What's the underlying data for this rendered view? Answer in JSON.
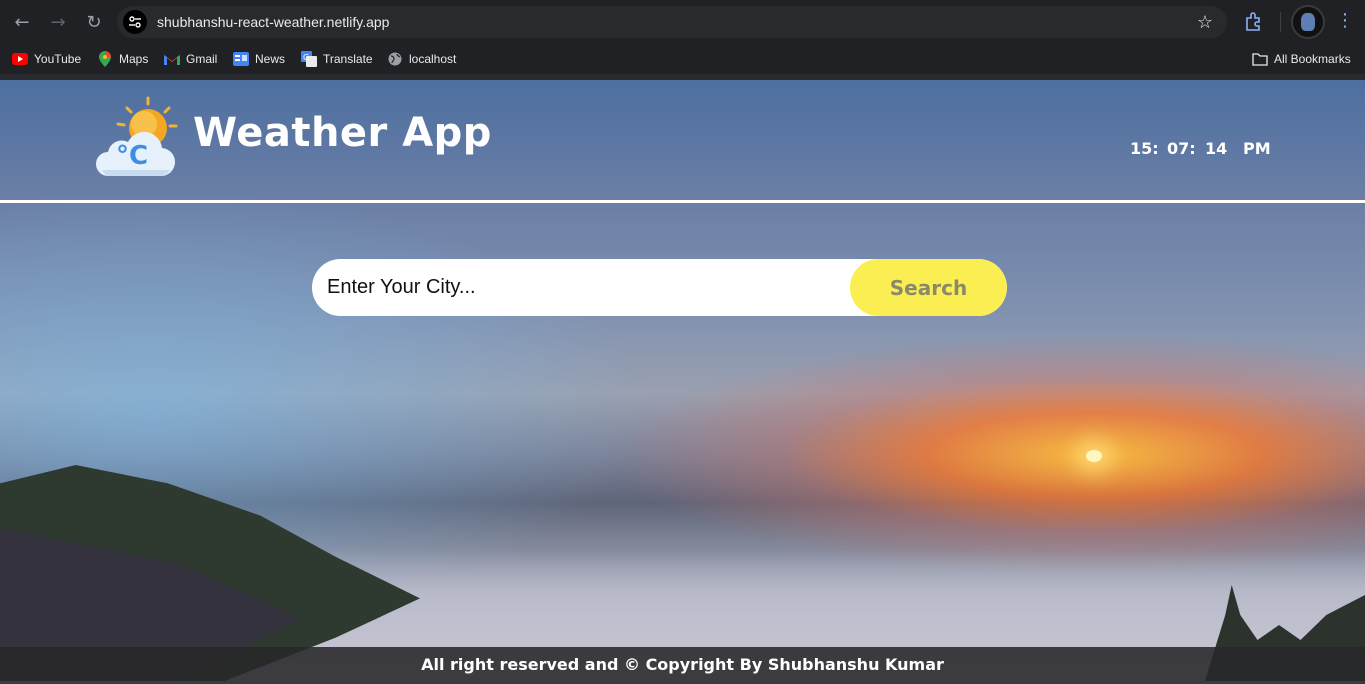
{
  "browser": {
    "url": "shubhanshu-react-weather.netlify.app",
    "bookmarks": [
      {
        "label": "YouTube",
        "icon": "youtube-icon"
      },
      {
        "label": "Maps",
        "icon": "maps-icon"
      },
      {
        "label": "Gmail",
        "icon": "gmail-icon"
      },
      {
        "label": "News",
        "icon": "news-icon"
      },
      {
        "label": "Translate",
        "icon": "translate-icon"
      },
      {
        "label": "localhost",
        "icon": "globe-icon"
      }
    ],
    "all_bookmarks_label": "All Bookmarks"
  },
  "header": {
    "title": "Weather App",
    "clock": {
      "hours": "15:",
      "minutes": "07:",
      "seconds": "14",
      "ampm": "PM"
    }
  },
  "search": {
    "placeholder": "Enter Your City...",
    "button_label": "Search"
  },
  "footer": {
    "text": "All right reserved and © Copyright By Shubhanshu Kumar"
  },
  "colors": {
    "search_button": "#fbee52",
    "header_line": "#ffffff",
    "footer_bg": "#28282a"
  }
}
